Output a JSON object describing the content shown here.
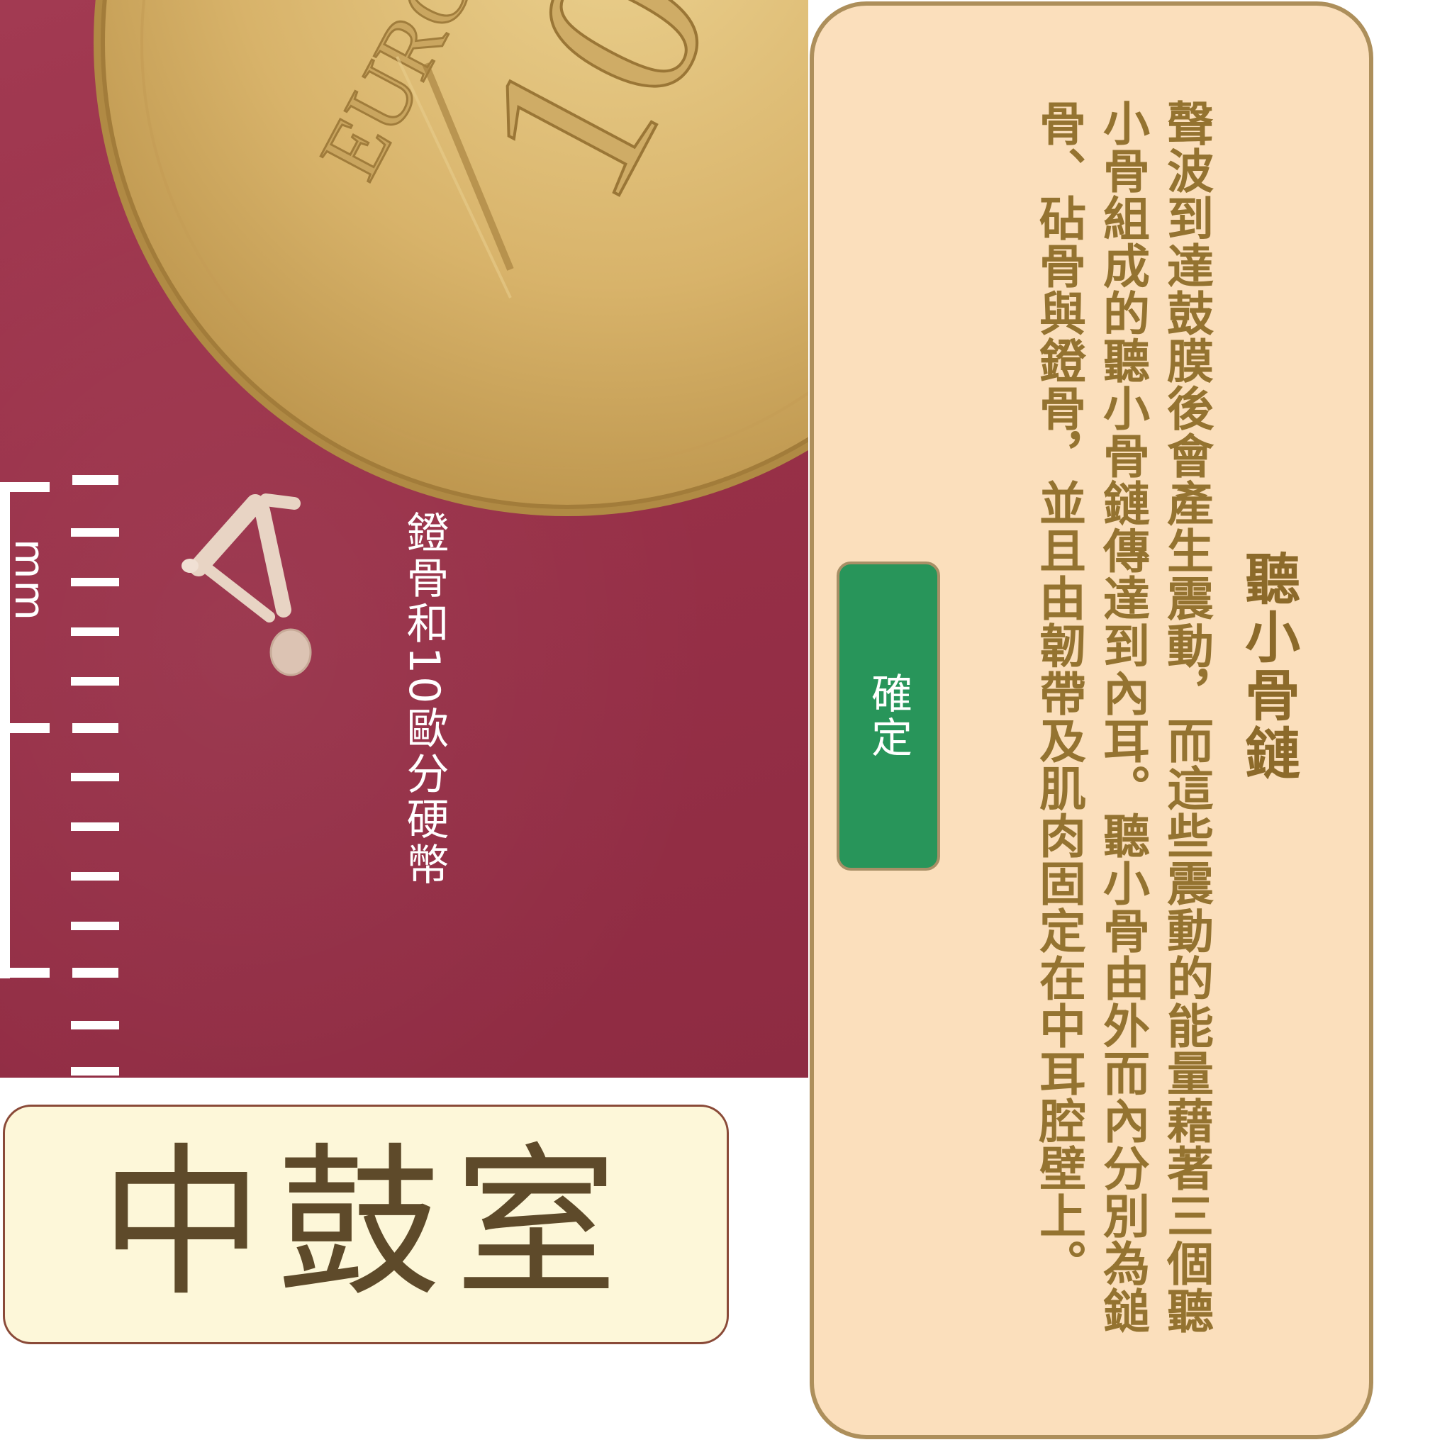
{
  "photo": {
    "caption": "鐙骨和10歐分硬幣",
    "ruler_unit": "mm",
    "coin": {
      "denomination": "10",
      "currency_text": "EURO CENT"
    }
  },
  "label": {
    "text": "中鼓室"
  },
  "dialog": {
    "title": "聽小骨鏈",
    "body": "聲波到達鼓膜後會產生震動，而這些震動的能量藉著三個聽小骨組成的聽小骨鏈傳達到內耳。聽小骨由外而內分別為鎚骨、砧骨與鐙骨，並且由韌帶及肌肉固定在中耳腔壁上。",
    "confirm_label": "確定"
  },
  "colors": {
    "photo_background": "#9a3149",
    "coin_gold": "#d8b36a",
    "label_background": "#fdf7d9",
    "label_text": "#5e4a2a",
    "dialog_background": "#fbdfbc",
    "dialog_border": "#ad8f5b",
    "dialog_text": "#947330",
    "button_green": "#28955a"
  }
}
